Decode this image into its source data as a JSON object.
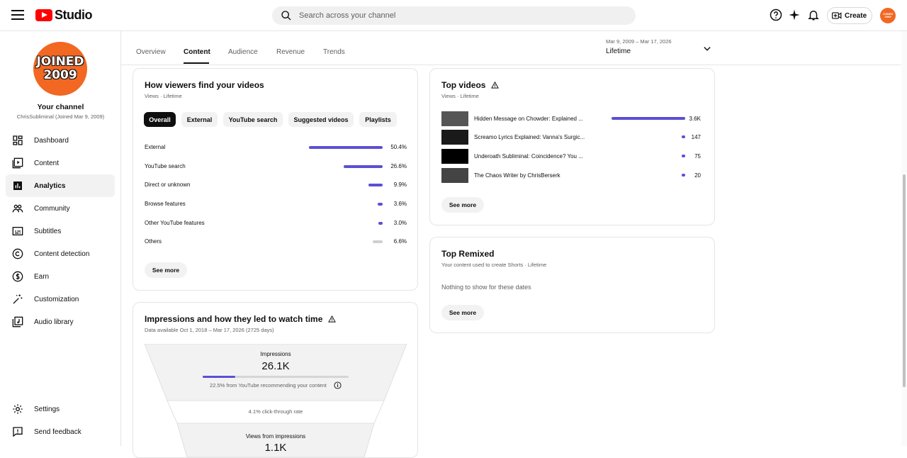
{
  "app": {
    "title": "Studio"
  },
  "search": {
    "placeholder": "Search across your channel"
  },
  "header": {
    "create_label": "Create",
    "avatar_text": "JOINED 2009"
  },
  "sidebar": {
    "avatar_line1": "JOINED",
    "avatar_line2": "2009",
    "channel_title": "Your channel",
    "channel_sub": "ChrisSubliminal (Joined Mar 9, 2009)",
    "items": [
      {
        "label": "Dashboard",
        "icon": "dashboard-icon"
      },
      {
        "label": "Content",
        "icon": "content-icon"
      },
      {
        "label": "Analytics",
        "icon": "analytics-icon"
      },
      {
        "label": "Community",
        "icon": "community-icon"
      },
      {
        "label": "Subtitles",
        "icon": "subtitles-icon"
      },
      {
        "label": "Content detection",
        "icon": "copyright-icon"
      },
      {
        "label": "Earn",
        "icon": "dollar-icon"
      },
      {
        "label": "Customization",
        "icon": "magic-wand-icon"
      },
      {
        "label": "Audio library",
        "icon": "audio-library-icon"
      }
    ],
    "bottom": [
      {
        "label": "Settings",
        "icon": "gear-icon"
      },
      {
        "label": "Send feedback",
        "icon": "feedback-icon"
      }
    ]
  },
  "tabs": [
    "Overview",
    "Content",
    "Audience",
    "Revenue",
    "Trends"
  ],
  "date": {
    "range": "Mar 9, 2009 – Mar 17, 2026",
    "label": "Lifetime"
  },
  "traffic": {
    "title": "How viewers find your videos",
    "subtitle": "Views · Lifetime",
    "chips": [
      "Overall",
      "External",
      "YouTube search",
      "Suggested videos",
      "Playlists"
    ],
    "rows": [
      {
        "label": "External",
        "value": "50.4%",
        "pct": 50.4
      },
      {
        "label": "YouTube search",
        "value": "26.6%",
        "pct": 26.6
      },
      {
        "label": "Direct or unknown",
        "value": "9.9%",
        "pct": 9.9
      },
      {
        "label": "Browse features",
        "value": "3.6%",
        "pct": 3.6
      },
      {
        "label": "Other YouTube features",
        "value": "3.0%",
        "pct": 3.0
      },
      {
        "label": "Others",
        "value": "6.6%",
        "pct": 6.6
      }
    ],
    "see_more": "See more"
  },
  "impressions": {
    "title": "Impressions and how they led to watch time",
    "subtitle": "Data available Oct 1, 2018 – Mar 17, 2026 (2725 days)",
    "impressions_label": "Impressions",
    "impressions_value": "26.1K",
    "recommend_pct": 22.5,
    "recommend_text": "22.5% from YouTube recommending your content",
    "ctr_text": "4.1% click-through rate",
    "views_label": "Views from impressions",
    "views_value": "1.1K"
  },
  "top_videos": {
    "title": "Top videos",
    "subtitle": "Views · Lifetime",
    "rows": [
      {
        "title": "Hidden Message on Chowder: Explained ...",
        "value": "3.6K",
        "views": 3600
      },
      {
        "title": "Screamo Lyrics Explained: Vanna's Surgic...",
        "value": "147",
        "views": 147
      },
      {
        "title": "Underoath Subliminal: Coincidence? You ...",
        "value": "75",
        "views": 75
      },
      {
        "title": "The Chaos Writer by ChrisBerserk",
        "value": "20",
        "views": 20
      }
    ],
    "see_more": "See more"
  },
  "top_remixed": {
    "title": "Top Remixed",
    "subtitle": "Your content used to create Shorts · Lifetime",
    "empty": "Nothing to show for these dates",
    "see_more": "See more"
  },
  "colors": {
    "accent": "#5b4fd4",
    "brand": "#ff0000",
    "avatar": "#f26722"
  }
}
